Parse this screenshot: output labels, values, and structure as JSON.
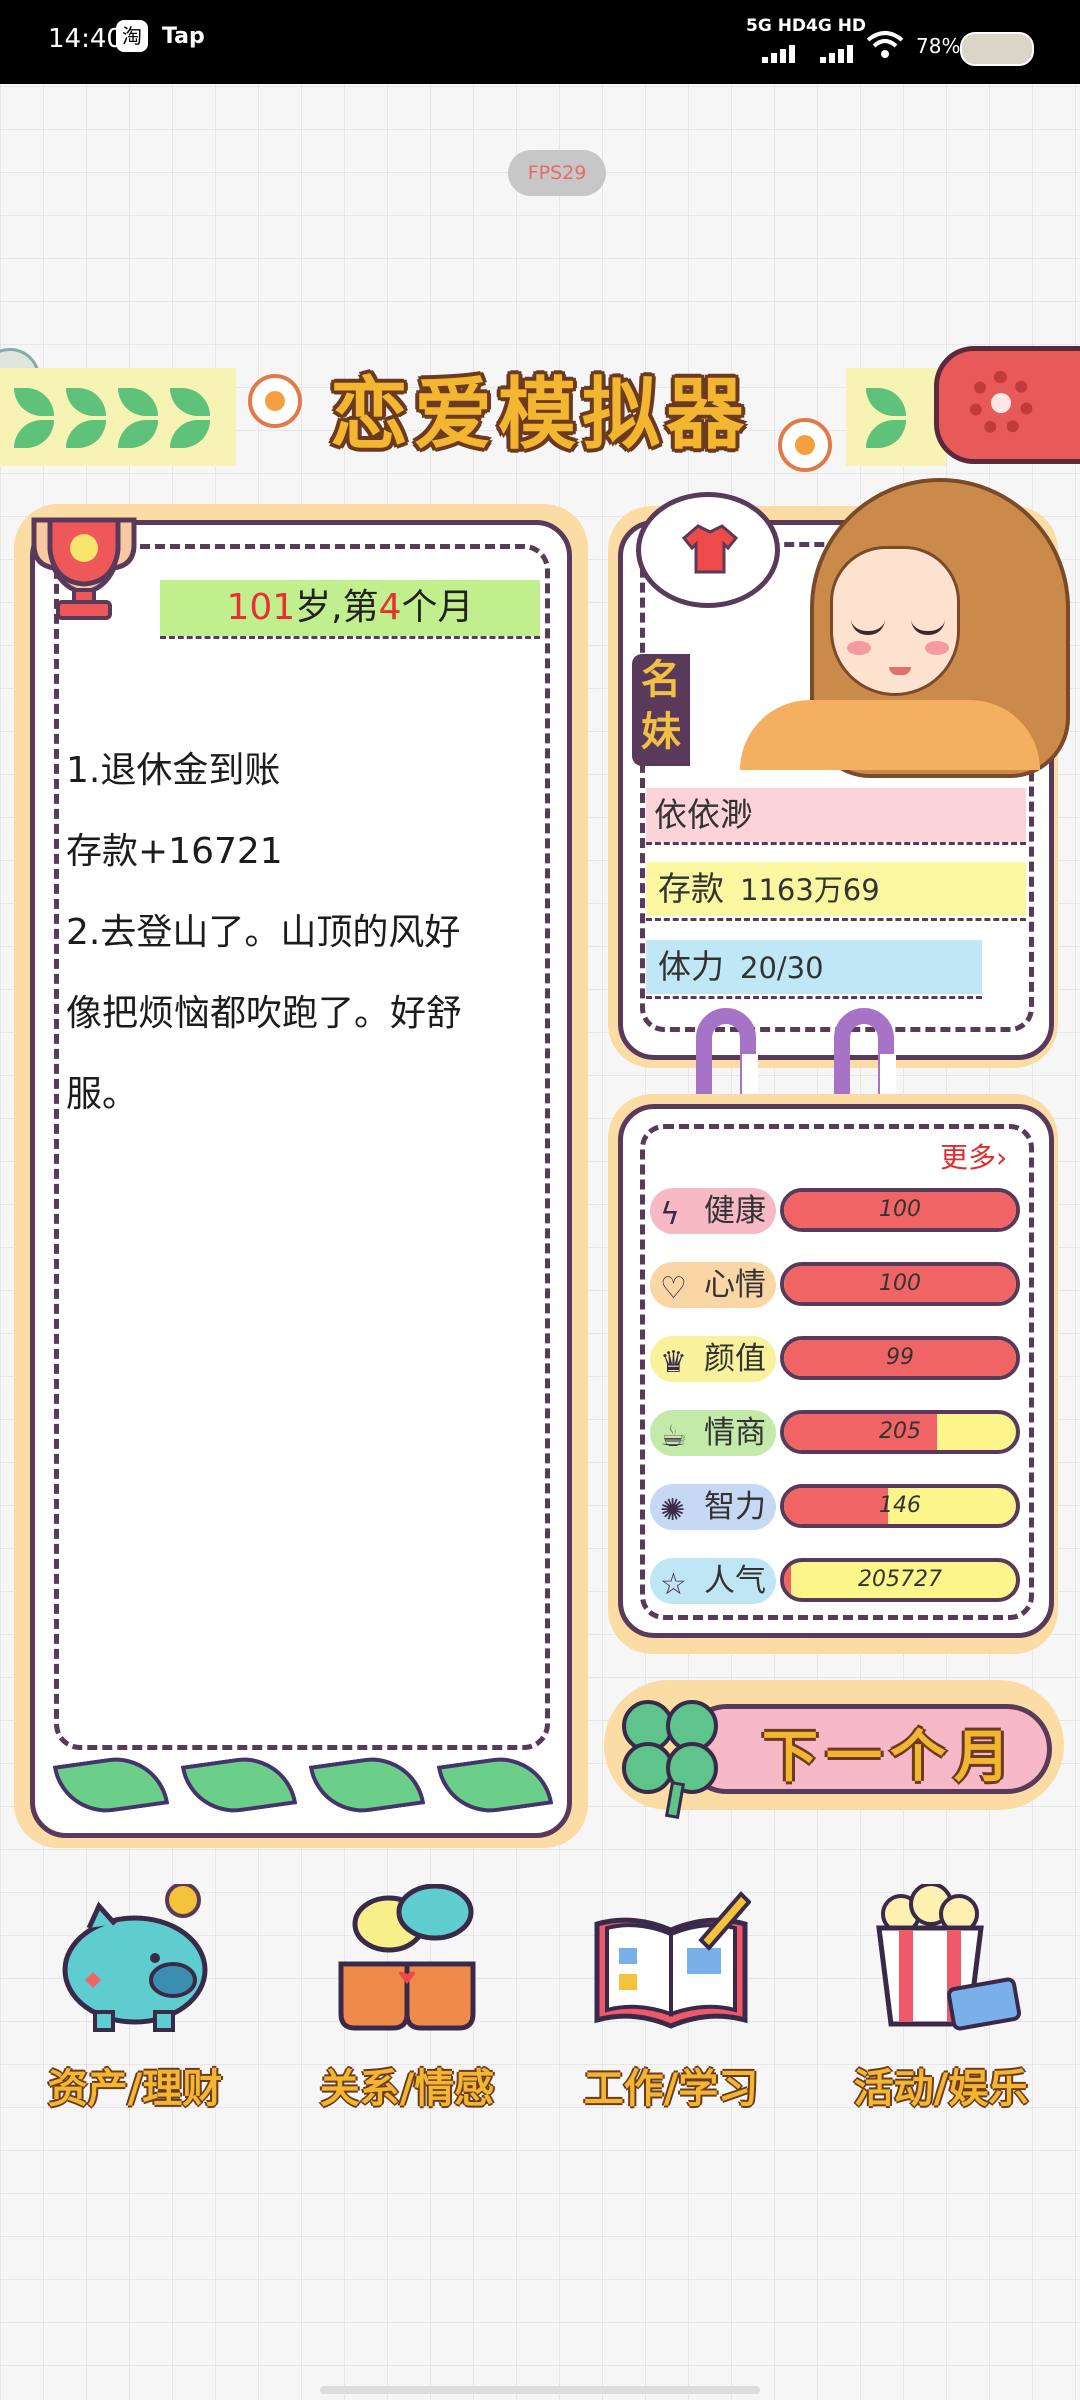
{
  "status_bar": {
    "time": "14:40",
    "app_icon_1": "淘",
    "app_icon_2": "Tap",
    "network_1": "5G HD",
    "network_2": "4G HD",
    "battery": "78%"
  },
  "fps": "FPS29",
  "title": "恋爱模拟器",
  "event": {
    "age_prefix": "101岁,第",
    "month_num": "4",
    "month_suffix": "个月",
    "line1_num": "1.",
    "line1_text": "退休金到账",
    "line2": "存款+16721",
    "line3_num": "2.",
    "line3_text": "去登山了。山顶的风好",
    "line4": "像把烦恼都吹跑了。好舒",
    "line5": "服。"
  },
  "character": {
    "tag": "名妹",
    "name": "依依渺",
    "money_label": "存款",
    "money_value": "1163万69",
    "stamina_label": "体力",
    "stamina_value": "20/30"
  },
  "stats": {
    "more": "更多›",
    "items": [
      {
        "label": "健康",
        "value": "100",
        "fill": 1.0,
        "icon": "lightning-icon",
        "glyph": "ϟ",
        "color": "#f7b9c3"
      },
      {
        "label": "心情",
        "value": "100",
        "fill": 1.0,
        "icon": "heart-icon",
        "glyph": "♡",
        "color": "#fbd6a5"
      },
      {
        "label": "颜值",
        "value": "99",
        "fill": 1.0,
        "icon": "crown-icon",
        "glyph": "♛",
        "color": "#f8f29c"
      },
      {
        "label": "情商",
        "value": "205",
        "fill": 0.66,
        "icon": "teacup-icon",
        "glyph": "☕",
        "color": "#c3eaa8"
      },
      {
        "label": "智力",
        "value": "146",
        "fill": 0.45,
        "icon": "lightbulb-icon",
        "glyph": "✺",
        "color": "#c7d8f5"
      },
      {
        "label": "人气",
        "value": "205727",
        "fill": 0.03,
        "icon": "star-icon",
        "glyph": "☆",
        "color": "#bfe6f4"
      }
    ]
  },
  "next_button": "下一个月",
  "menu": [
    {
      "label": "资产/理财",
      "icon": "piggy-bank-icon"
    },
    {
      "label": "关系/情感",
      "icon": "coffee-cups-icon"
    },
    {
      "label": "工作/学习",
      "icon": "open-book-icon"
    },
    {
      "label": "活动/娱乐",
      "icon": "popcorn-icon"
    }
  ],
  "colors": {
    "title_fill": "#f2b630",
    "outline": "#5a3a5a",
    "panel_border": "#fbdca5",
    "stat_fill": "#f06466",
    "stat_track": "#fbf58c"
  }
}
